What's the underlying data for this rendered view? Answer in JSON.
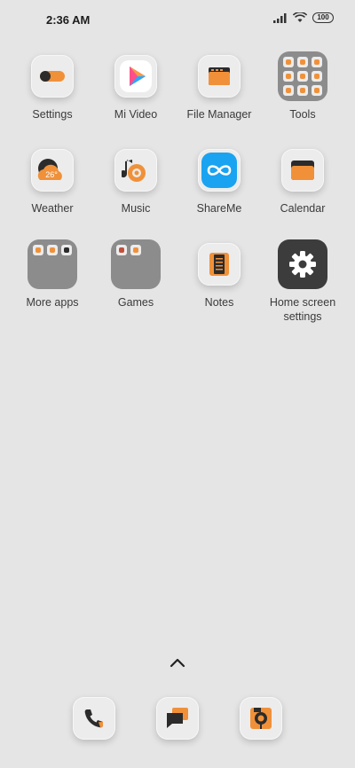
{
  "status_bar": {
    "time": "2:36 AM",
    "battery": "100"
  },
  "apps": [
    {
      "label": "Settings"
    },
    {
      "label": "Mi Video"
    },
    {
      "label": "File Manager"
    },
    {
      "label": "Tools"
    },
    {
      "label": "Weather",
      "temp": "26°"
    },
    {
      "label": "Music"
    },
    {
      "label": "ShareMe"
    },
    {
      "label": "Calendar"
    },
    {
      "label": "More apps"
    },
    {
      "label": "Games"
    },
    {
      "label": "Notes"
    },
    {
      "label": "Home screen settings"
    }
  ],
  "dock": [
    {
      "icon": "phone-icon"
    },
    {
      "icon": "messages-icon"
    },
    {
      "icon": "camera-icon"
    }
  ],
  "colors": {
    "accent": "#f0913a",
    "dark": "#2b2b2b",
    "background": "#e5e5e5",
    "share_blue": "#1aa3f0"
  }
}
